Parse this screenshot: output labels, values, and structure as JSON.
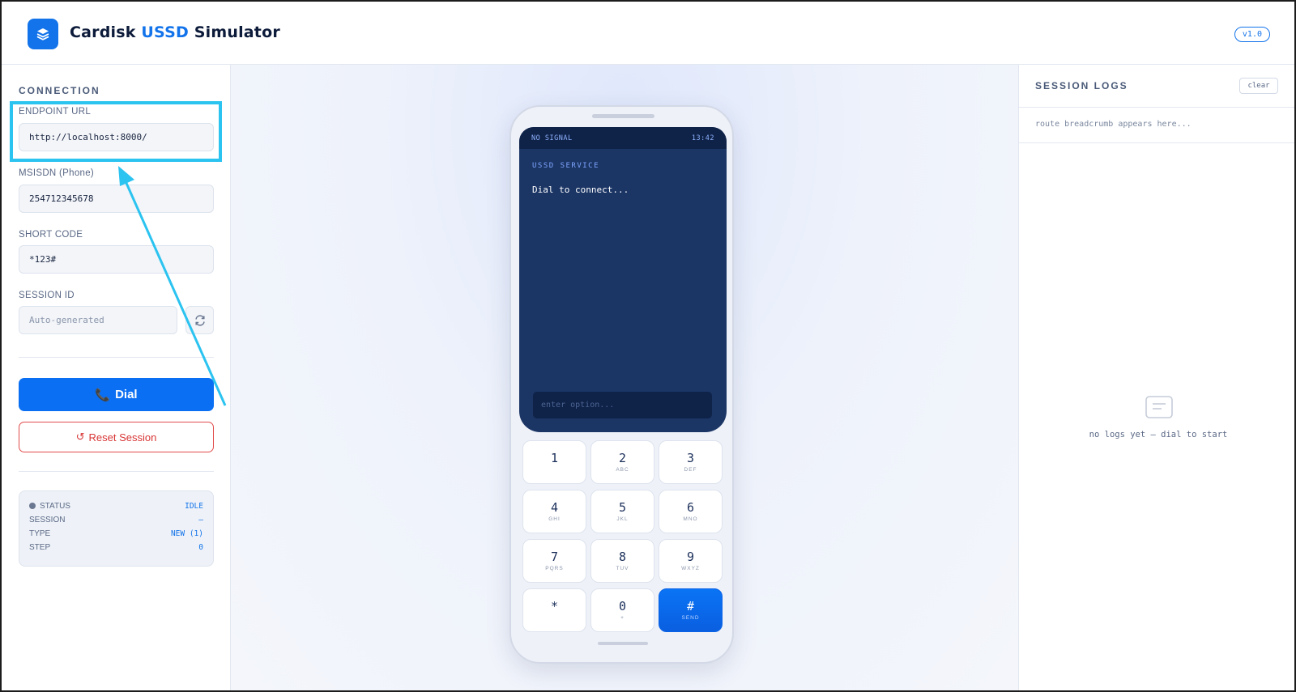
{
  "header": {
    "brand_part1": "Cardisk ",
    "brand_accent": "USSD",
    "brand_part2": " Simulator",
    "version": "v1.0",
    "logo_icon": "layers-icon"
  },
  "connection": {
    "section_title": "CONNECTION",
    "endpoint": {
      "label": "ENDPOINT URL",
      "value": "http://localhost:8000/"
    },
    "msisdn": {
      "label": "MSISDN (Phone)",
      "value": "254712345678"
    },
    "short_code": {
      "label": "SHORT CODE",
      "value": "*123#"
    },
    "session_id": {
      "label": "SESSION ID",
      "value": "",
      "placeholder": "Auto-generated",
      "regen_icon": "refresh-icon"
    },
    "dial_label": "Dial",
    "dial_icon": "📞",
    "reset_label": "Reset Session",
    "reset_icon": "↺"
  },
  "status": {
    "rows": [
      {
        "key": "STATUS",
        "value": "IDLE"
      },
      {
        "key": "SESSION",
        "value": "–"
      },
      {
        "key": "TYPE",
        "value": "NEW (1)"
      },
      {
        "key": "STEP",
        "value": "0"
      }
    ]
  },
  "phone": {
    "signal": "NO SIGNAL",
    "time": "13:42",
    "service_title": "USSD SERVICE",
    "message": "Dial to connect...",
    "option_placeholder": "enter option...",
    "keys": [
      {
        "num": "1",
        "sub": ""
      },
      {
        "num": "2",
        "sub": "ABC"
      },
      {
        "num": "3",
        "sub": "DEF"
      },
      {
        "num": "4",
        "sub": "GHI"
      },
      {
        "num": "5",
        "sub": "JKL"
      },
      {
        "num": "6",
        "sub": "MNO"
      },
      {
        "num": "7",
        "sub": "PQRS"
      },
      {
        "num": "8",
        "sub": "TUV"
      },
      {
        "num": "9",
        "sub": "WXYZ"
      },
      {
        "num": "*",
        "sub": ""
      },
      {
        "num": "0",
        "sub": "+"
      },
      {
        "num": "#",
        "sub": "SEND"
      }
    ]
  },
  "logs": {
    "title": "SESSION LOGS",
    "clear_label": "clear",
    "breadcrumb": "route breadcrumb appears here...",
    "empty_text": "no logs yet — dial to start",
    "empty_icon": "document-icon"
  },
  "colors": {
    "accent": "#1273ea",
    "danger": "#d93636",
    "screen": "#1b3565",
    "highlight": "#2bc3f0"
  }
}
